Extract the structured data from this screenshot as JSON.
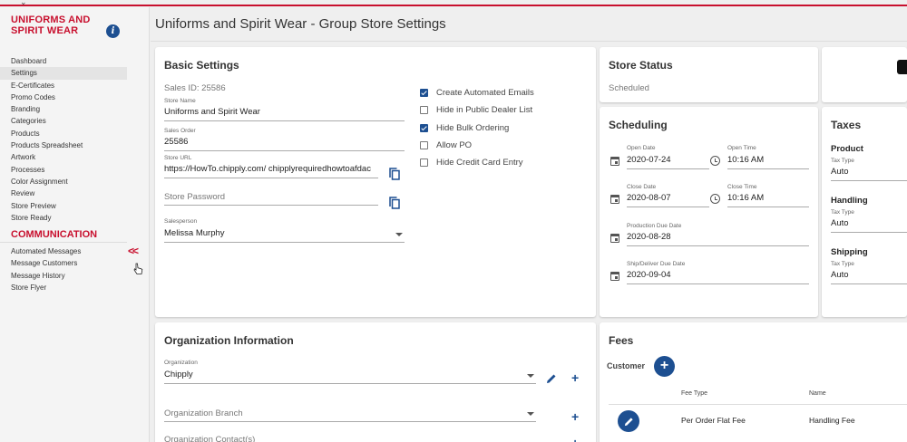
{
  "sidebar": {
    "brand": "UNIFORMS AND SPIRIT WEAR",
    "info_glyph": "i",
    "items": [
      "Dashboard",
      "Settings",
      "E-Certificates",
      "Promo Codes",
      "Branding",
      "Categories",
      "Products",
      "Products Spreadsheet",
      "Artwork",
      "Processes",
      "Color Assignment",
      "Review",
      "Store Preview",
      "Store Ready"
    ],
    "active_index": 1,
    "section": "COMMUNICATION",
    "comm_items": [
      "Automated Messages",
      "Message Customers",
      "Message History",
      "Store Flyer"
    ],
    "collapse_glyph": "<<"
  },
  "header": {
    "title": "Uniforms and Spirit Wear - Group Store Settings"
  },
  "basic": {
    "title": "Basic Settings",
    "sales_id": "Sales ID: 25586",
    "store_name_label": "Store Name",
    "store_name": "Uniforms and Spirit Wear",
    "sales_order_label": "Sales Order",
    "sales_order": "25586",
    "store_url_label": "Store URL",
    "store_url": "https://HowTo.chipply.com/ chipplyrequiredhowtoafdac",
    "password_placeholder": "Store Password",
    "salesperson_label": "Salesperson",
    "salesperson": "Melissa Murphy",
    "checkboxes": [
      {
        "label": "Create Automated Emails",
        "checked": true
      },
      {
        "label": "Hide in Public Dealer List",
        "checked": false
      },
      {
        "label": "Hide Bulk Ordering",
        "checked": true
      },
      {
        "label": "Allow PO",
        "checked": false
      },
      {
        "label": "Hide Credit Card Entry",
        "checked": false
      }
    ]
  },
  "status": {
    "title": "Store Status",
    "value": "Scheduled"
  },
  "scheduling": {
    "title": "Scheduling",
    "open_date_label": "Open Date",
    "open_date": "2020-07-24",
    "open_time_label": "Open Time",
    "open_time": "10:16 AM",
    "close_date_label": "Close Date",
    "close_date": "2020-08-07",
    "close_time_label": "Close Time",
    "close_time": "10:16 AM",
    "production_label": "Production Due Date",
    "production": "2020-08-28",
    "ship_label": "Ship/Deliver Due Date",
    "ship": "2020-09-04"
  },
  "taxes": {
    "title": "Taxes",
    "groups": [
      {
        "heading": "Product",
        "label": "Tax Type",
        "value": "Auto"
      },
      {
        "heading": "Handling",
        "label": "Tax Type",
        "value": "Auto"
      },
      {
        "heading": "Shipping",
        "label": "Tax Type",
        "value": "Auto"
      }
    ]
  },
  "org": {
    "title": "Organization Information",
    "org_label": "Organization",
    "org_value": "Chipply",
    "branch_placeholder": "Organization Branch",
    "contacts_placeholder": "Organization Contact(s)",
    "plus_glyph": "+"
  },
  "fees": {
    "title": "Fees",
    "customer_label": "Customer",
    "plus_glyph": "+",
    "columns": [
      "Fee Type",
      "Name"
    ],
    "rows": [
      {
        "fee_type": "Per Order Flat Fee",
        "name": "Handling Fee"
      }
    ]
  },
  "colors": {
    "accent": "#1d4f91",
    "brand_red": "#c8102e"
  },
  "icons": [
    "info-icon",
    "copy-icon",
    "calendar-icon",
    "clock-icon",
    "pencil-icon",
    "plus-icon",
    "chevron-down-icon",
    "collapse-icon",
    "pointer-cursor-icon"
  ]
}
